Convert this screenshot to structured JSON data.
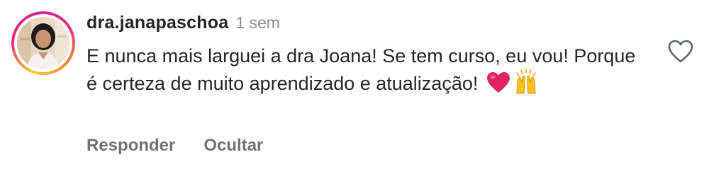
{
  "comment": {
    "username": "dra.janapaschoa",
    "timestamp": "1 sem",
    "text": "E nunca mais larguei a dra Joana! Se tem curso, eu vou! Porque é certeza de muito aprendizado e atualização!",
    "emojis": [
      "heart-icon",
      "raised-hands-icon"
    ],
    "actions": {
      "reply_label": "Responder",
      "hide_label": "Ocultar"
    }
  },
  "colors": {
    "text": "#262626",
    "muted": "#8e8e8e",
    "action": "#737373",
    "heart": "#e0245e",
    "like_outline": "#5c6670"
  }
}
